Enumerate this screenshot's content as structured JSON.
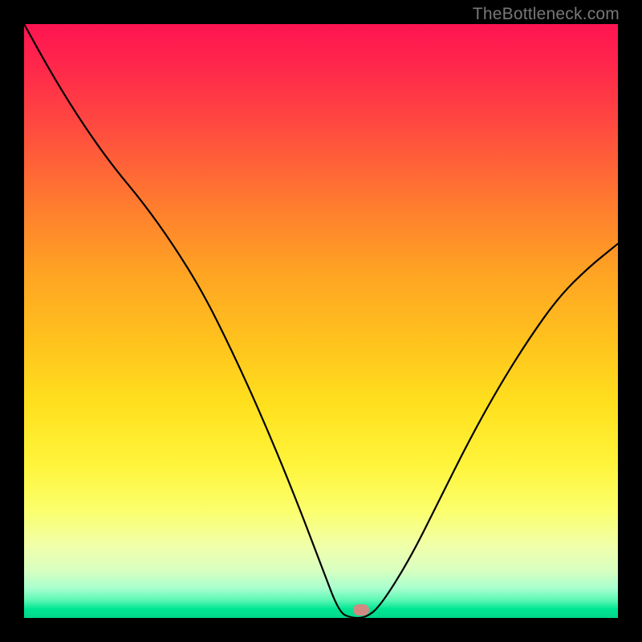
{
  "watermark": "TheBottleneck.com",
  "marker": {
    "x_frac": 0.567,
    "y_frac": 0.99
  },
  "chart_data": {
    "type": "line",
    "title": "",
    "xlabel": "",
    "ylabel": "",
    "xlim": [
      0,
      1
    ],
    "ylim": [
      0,
      1
    ],
    "x": [
      0.0,
      0.05,
      0.1,
      0.15,
      0.2,
      0.25,
      0.3,
      0.35,
      0.4,
      0.45,
      0.5,
      0.53,
      0.55,
      0.575,
      0.6,
      0.65,
      0.7,
      0.75,
      0.8,
      0.85,
      0.9,
      0.95,
      1.0
    ],
    "values": [
      1.0,
      0.91,
      0.83,
      0.76,
      0.7,
      0.63,
      0.55,
      0.45,
      0.34,
      0.22,
      0.09,
      0.01,
      0.0,
      0.0,
      0.02,
      0.1,
      0.2,
      0.3,
      0.39,
      0.47,
      0.54,
      0.59,
      0.63
    ],
    "gradient_note": "Background encodes bottleneck severity: green (0) at bottom to red (1) at top",
    "marker_point": {
      "x": 0.567,
      "y": 0.0
    }
  }
}
